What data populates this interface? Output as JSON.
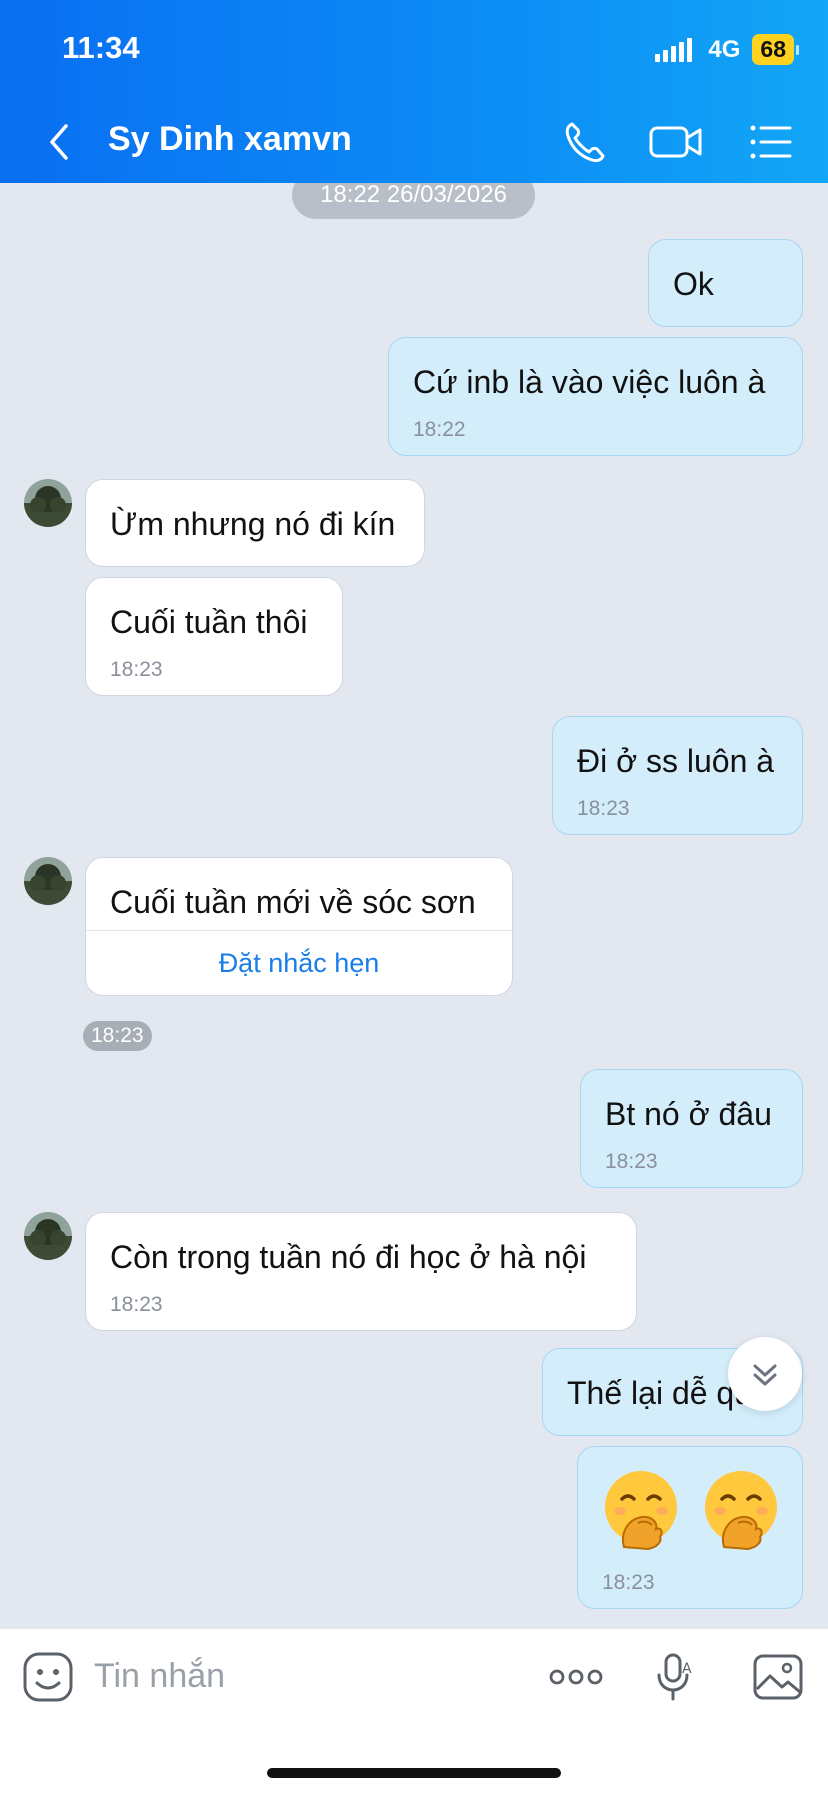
{
  "status": {
    "time": "11:34",
    "network": "4G",
    "battery": "68"
  },
  "header": {
    "title": "Sy Dinh xamvn"
  },
  "icons": {
    "back": "chevron-left-icon",
    "call": "phone-icon",
    "video": "video-camera-icon",
    "menu": "list-menu-icon",
    "sticker": "smiley-icon",
    "more": "more-dots-icon",
    "voice": "microphone-icon",
    "image": "image-icon",
    "scroll": "chevron-double-down-icon"
  },
  "chat": {
    "date_separator": "18:22 26/03/2026",
    "messages": [
      {
        "dir": "out",
        "text": "Ok",
        "time": ""
      },
      {
        "dir": "out",
        "text": "Cứ inb là vào việc luôn à",
        "time": "18:22"
      },
      {
        "dir": "in",
        "text": "Ừm nhưng nó đi kín",
        "time": ""
      },
      {
        "dir": "in",
        "text": "Cuối tuần thôi",
        "time": "18:23"
      },
      {
        "dir": "out",
        "text": "Đi ở ss luôn à",
        "time": "18:23"
      },
      {
        "dir": "in",
        "text": "Cuối tuần mới về sóc sơn",
        "action": "Đặt nhắc hẹn",
        "time": "18:23"
      },
      {
        "dir": "out",
        "text": "Bt nó ở đâu",
        "time": "18:23"
      },
      {
        "dir": "in",
        "text": "Còn trong tuần nó đi học ở hà nội",
        "time": "18:23"
      },
      {
        "dir": "out",
        "text": "Thế lại dễ quá",
        "time": ""
      },
      {
        "dir": "out",
        "emoji": [
          "face-with-hand-over-mouth",
          "face-with-hand-over-mouth"
        ],
        "time": "18:23"
      }
    ]
  },
  "composer": {
    "placeholder": "Tin nhắn"
  },
  "colors": {
    "header_start": "#0a6ff2",
    "header_end": "#12a6f6",
    "outgoing_bubble": "#d4edfb",
    "incoming_bubble": "#ffffff",
    "chat_bg": "#e2e7f0",
    "link": "#1a7ee8"
  }
}
